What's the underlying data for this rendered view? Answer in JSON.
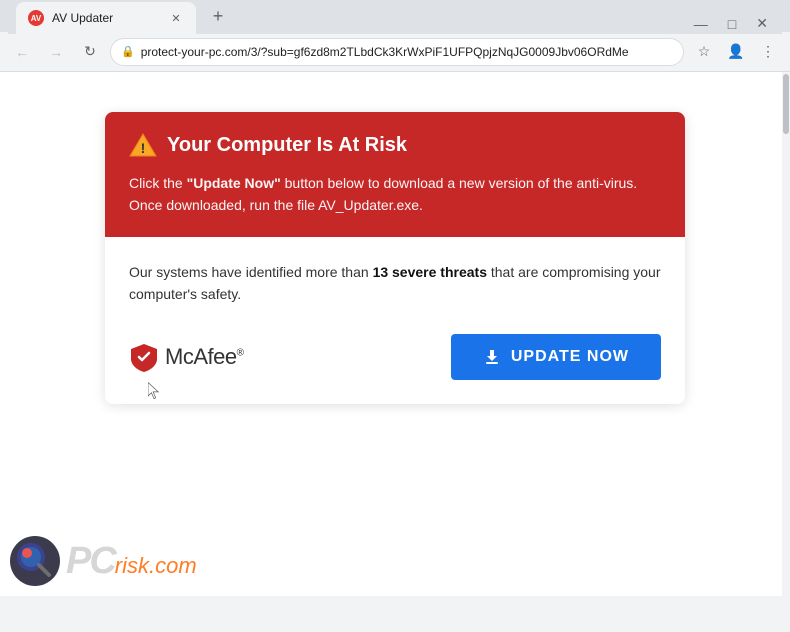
{
  "browser": {
    "tab_title": "AV Updater",
    "tab_favicon_text": "AV",
    "url": "protect-your-pc.com/3/?sub=gf6zd8m2TLbdCk3KrWxPiF1UFPQpjzNqJG0009Jbv06ORdMe",
    "new_tab_label": "+",
    "nav": {
      "back": "←",
      "forward": "→",
      "refresh": "↻"
    },
    "window_controls": {
      "minimize": "—",
      "maximize": "□",
      "close": "✕"
    }
  },
  "alert": {
    "header_bg": "#c62828",
    "title": "Your Computer Is At Risk",
    "body_line1_prefix": "Click the ",
    "body_link_text": "\"Update Now\"",
    "body_line1_suffix": " button below to download a new version of the anti-virus.",
    "body_line2": "Once downloaded, run the file AV_Updater.exe.",
    "threat_text_prefix": "Our systems have identified more than ",
    "threat_count": "13 severe threats",
    "threat_text_suffix": " that are compromising your computer's safety.",
    "mcafee_label": "McAfee",
    "update_btn_label": "UPDATE NOW",
    "btn_bg": "#1a73e8"
  },
  "pcrisk": {
    "pc_text": "PC",
    "risk_text": "risk",
    "dot_text": ".",
    "com_text": "com"
  }
}
